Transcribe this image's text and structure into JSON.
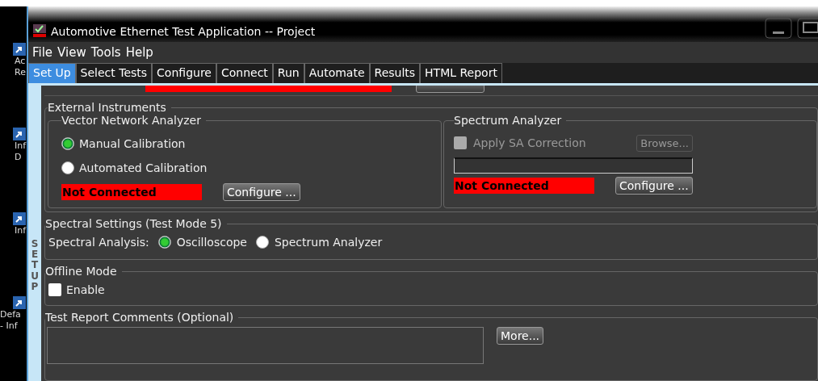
{
  "desktop_icons": [
    {
      "lines": [
        "Ac",
        "Re"
      ]
    },
    {
      "lines": [
        "Inf",
        "D"
      ]
    },
    {
      "lines": [
        "Inf"
      ]
    },
    {
      "lines": [
        "Defa",
        "- Inf"
      ]
    }
  ],
  "window": {
    "title": "Automotive Ethernet Test Application -- Project"
  },
  "menu": [
    "File",
    "View",
    "Tools",
    "Help"
  ],
  "tabs": [
    {
      "label": "Set Up",
      "selected": true
    },
    {
      "label": "Select Tests",
      "selected": false
    },
    {
      "label": "Configure",
      "selected": false
    },
    {
      "label": "Connect",
      "selected": false
    },
    {
      "label": "Run",
      "selected": false
    },
    {
      "label": "Automate",
      "selected": false
    },
    {
      "label": "Results",
      "selected": false
    },
    {
      "label": "HTML Report",
      "selected": false
    }
  ],
  "side_label": "SET UP",
  "external_instruments": {
    "title": "External Instruments",
    "vna": {
      "title": "Vector Network Analyzer",
      "options": [
        {
          "label": "Manual Calibration",
          "selected": true
        },
        {
          "label": "Automated Calibration",
          "selected": false
        }
      ],
      "status": "Not Connected",
      "button": "Configure ..."
    },
    "spectrum_analyzer": {
      "title": "Spectrum Analyzer",
      "correction": {
        "label": "Apply SA Correction",
        "checked": false,
        "disabled": true
      },
      "browse_button": {
        "label": "Browse...",
        "disabled": true
      },
      "status": "Not Connected",
      "button": "Configure ..."
    }
  },
  "spectral_settings": {
    "title": "Spectral Settings (Test Mode 5)",
    "label": "Spectral Analysis:",
    "options": [
      {
        "label": "Oscilloscope",
        "selected": true
      },
      {
        "label": "Spectrum Analyzer",
        "selected": false
      }
    ]
  },
  "offline_mode": {
    "title": "Offline Mode",
    "enable": {
      "label": "Enable",
      "checked": false
    }
  },
  "comments": {
    "title": "Test Report Comments (Optional)",
    "button": "More..."
  }
}
